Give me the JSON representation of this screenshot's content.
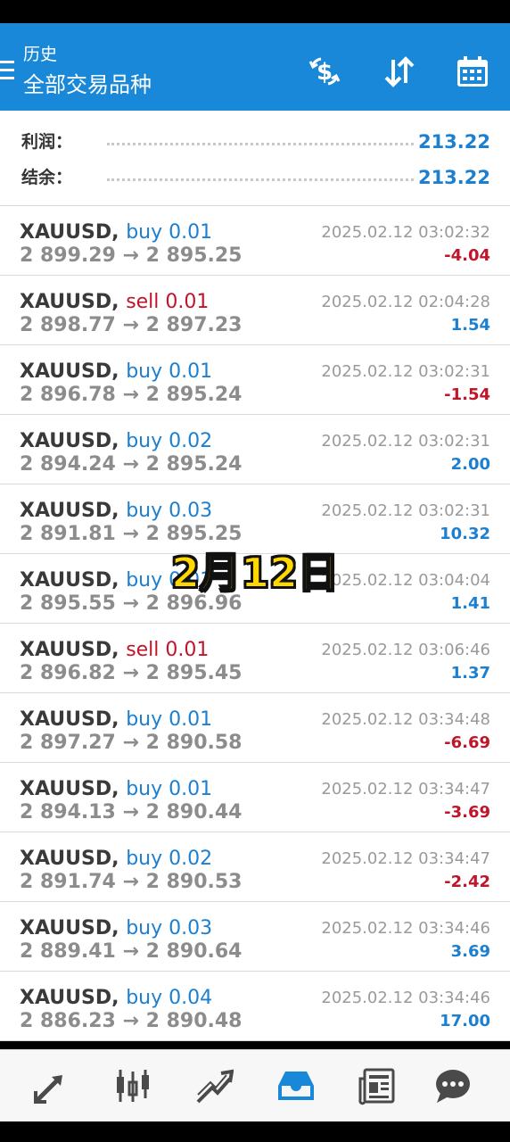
{
  "header": {
    "subtitle": "历史",
    "title": "全部交易品种",
    "bg_color": "#1a88d8",
    "icons": [
      "dollar-sync-icon",
      "sort-icon",
      "calendar-icon"
    ]
  },
  "summary": {
    "profit_label": "利润：",
    "profit_value": "213.22",
    "balance_label": "结余：",
    "balance_value": "213.22"
  },
  "trades": [
    {
      "symbol": "XAUUSD,",
      "side": "buy 0.01",
      "type": "buy",
      "prices": "2 899.29 → 2 895.25",
      "time": "2025.02.12 03:02:32",
      "pl": "-4.04"
    },
    {
      "symbol": "XAUUSD,",
      "side": "sell 0.01",
      "type": "sell",
      "prices": "2 898.77 → 2 897.23",
      "time": "2025.02.12 02:04:28",
      "pl": "1.54"
    },
    {
      "symbol": "XAUUSD,",
      "side": "buy 0.01",
      "type": "buy",
      "prices": "2 896.78 → 2 895.24",
      "time": "2025.02.12 03:02:31",
      "pl": "-1.54"
    },
    {
      "symbol": "XAUUSD,",
      "side": "buy 0.02",
      "type": "buy",
      "prices": "2 894.24 → 2 895.24",
      "time": "2025.02.12 03:02:31",
      "pl": "2.00"
    },
    {
      "symbol": "XAUUSD,",
      "side": "buy 0.03",
      "type": "buy",
      "prices": "2 891.81 → 2 895.25",
      "time": "2025.02.12 03:02:31",
      "pl": "10.32"
    },
    {
      "symbol": "XAUUSD,",
      "side": "buy 0.01",
      "type": "buy",
      "prices": "2 895.55 → 2 896.96",
      "time": "2025.02.12 03:04:04",
      "pl": "1.41"
    },
    {
      "symbol": "XAUUSD,",
      "side": "sell 0.01",
      "type": "sell",
      "prices": "2 896.82 → 2 895.45",
      "time": "2025.02.12 03:06:46",
      "pl": "1.37"
    },
    {
      "symbol": "XAUUSD,",
      "side": "buy 0.01",
      "type": "buy",
      "prices": "2 897.27 → 2 890.58",
      "time": "2025.02.12 03:34:48",
      "pl": "-6.69"
    },
    {
      "symbol": "XAUUSD,",
      "side": "buy 0.01",
      "type": "buy",
      "prices": "2 894.13 → 2 890.44",
      "time": "2025.02.12 03:34:47",
      "pl": "-3.69"
    },
    {
      "symbol": "XAUUSD,",
      "side": "buy 0.02",
      "type": "buy",
      "prices": "2 891.74 → 2 890.53",
      "time": "2025.02.12 03:34:47",
      "pl": "-2.42"
    },
    {
      "symbol": "XAUUSD,",
      "side": "buy 0.03",
      "type": "buy",
      "prices": "2 889.41 → 2 890.64",
      "time": "2025.02.12 03:34:46",
      "pl": "3.69"
    },
    {
      "symbol": "XAUUSD,",
      "side": "buy 0.04",
      "type": "buy",
      "prices": "2 886.23 → 2 890.48",
      "time": "2025.02.12 03:34:46",
      "pl": "17.00"
    }
  ],
  "overlay_text": "2月12日",
  "colors": {
    "positive": "#1c7fcf",
    "negative": "#c0152a",
    "overlay": "#ffd800",
    "nav_active": "#1a88d8",
    "nav_inactive": "#4a4a4a"
  },
  "bottom_nav": {
    "items": [
      "quotes-icon",
      "chart-icon",
      "trade-icon",
      "history-icon",
      "news-icon",
      "chat-icon"
    ],
    "active": "history-icon"
  }
}
